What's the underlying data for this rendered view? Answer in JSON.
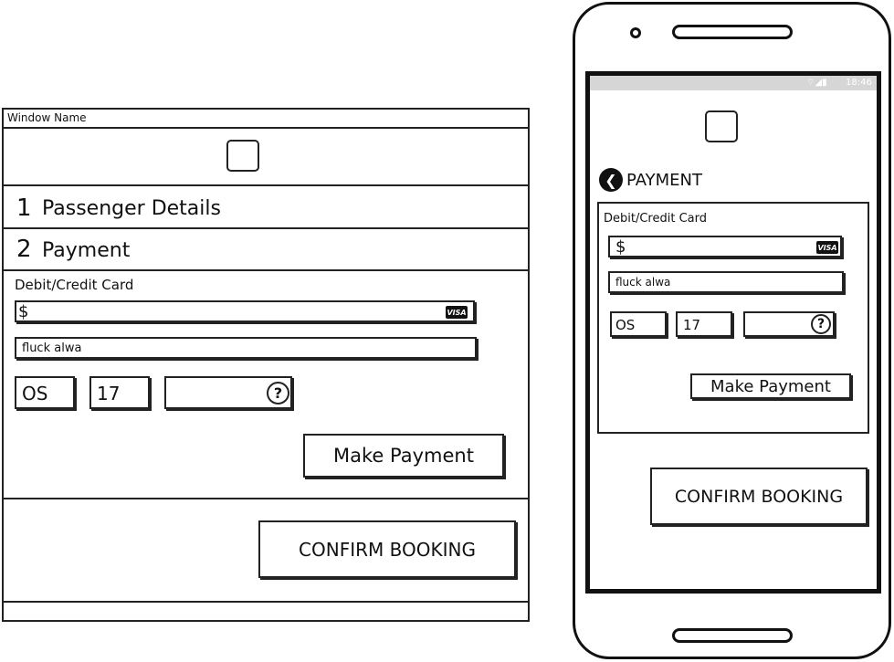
{
  "desktop": {
    "window_title": "Window Name",
    "steps": [
      {
        "number": "1",
        "label": "Passenger Details"
      },
      {
        "number": "2",
        "label": "Payment"
      }
    ],
    "card_section_label": "Debit/Credit Card",
    "amount_prefix": "$",
    "card_brand": "VISA",
    "name_field_value": "fluck alwa",
    "expiry_month": "OS",
    "expiry_year": "17",
    "cvv_help": "?",
    "make_payment_label": "Make Payment",
    "confirm_label": "CONFIRM BOOKING"
  },
  "phone": {
    "status_time": "18:46",
    "header_title": "PAYMENT",
    "card_section_label": "Debit/Credit Card",
    "amount_prefix": "$",
    "card_brand": "VISA",
    "name_field_value": "fluck alwa",
    "expiry_month": "OS",
    "expiry_year": "17",
    "cvv_help": "?",
    "make_payment_label": "Make Payment",
    "confirm_label": "CONFIRM BOOKING"
  }
}
